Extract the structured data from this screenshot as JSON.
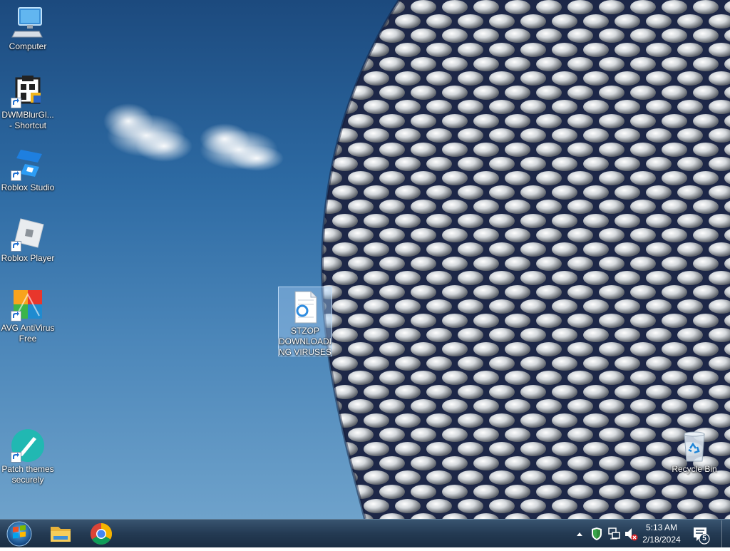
{
  "desktop": {
    "icons": [
      {
        "label": "Computer"
      },
      {
        "label": "DWMBlurGl... - Shortcut"
      },
      {
        "label": "Roblox Studio"
      },
      {
        "label": "Roblox Player"
      },
      {
        "label": "AVG AntiVirus Free"
      },
      {
        "label": "Patch themes securely"
      },
      {
        "label": "STZOP DOWNLOADING VIRUSES"
      },
      {
        "label": "Recycle Bin"
      }
    ]
  },
  "taskbar": {
    "pinned": [
      "start-orb-icon",
      "file-explorer-icon",
      "chrome-icon"
    ],
    "tray": {
      "time": "5:13 AM",
      "date": "2/18/2024",
      "notification_count": "5"
    }
  },
  "colors": {
    "sky_top": "#1c4a7e",
    "sky_bottom": "#6ea2cb",
    "taskbar": "#1c3550",
    "selection": "#a0c8f0"
  }
}
